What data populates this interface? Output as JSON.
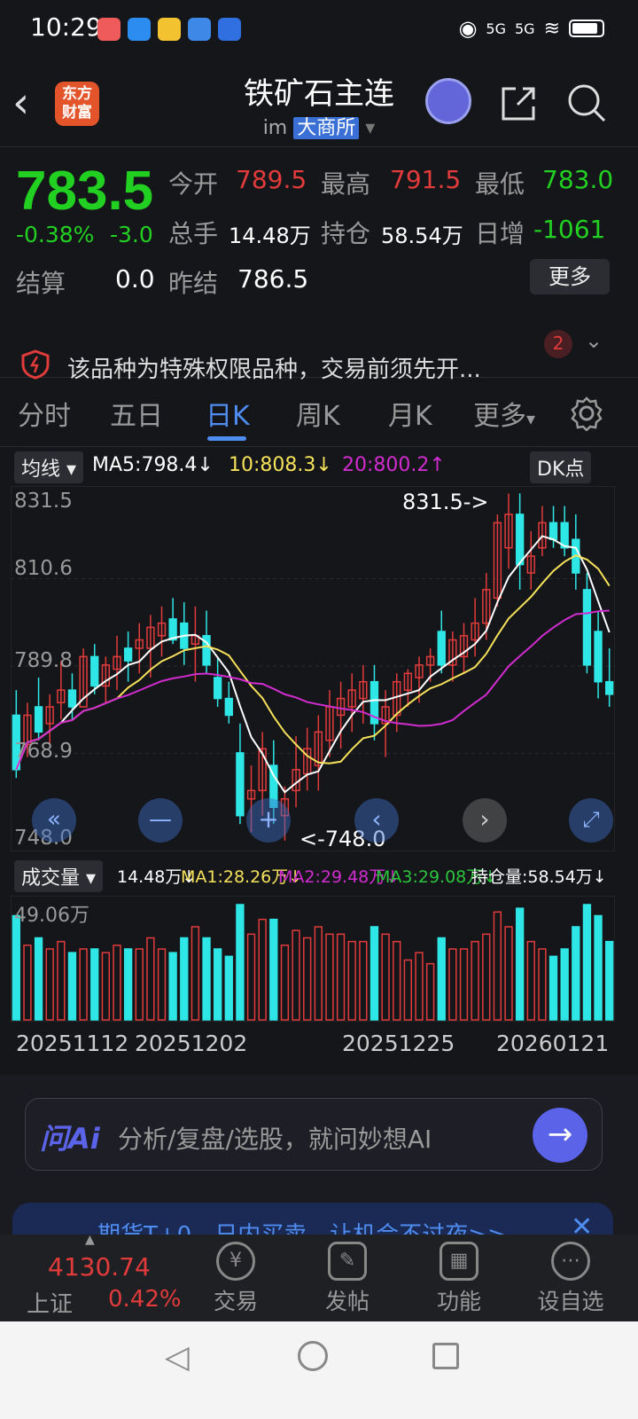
{
  "status_bar": {
    "time": "10:29",
    "signal_1": "5G",
    "signal_2": "5G"
  },
  "header": {
    "back_symbol": "‹",
    "logo_text_1": "东方",
    "logo_text_2": "财富",
    "title": "铁矿石主连",
    "sub_code": "im",
    "exchange": "大商所",
    "arrow": "▾"
  },
  "quote": {
    "price": "783.5",
    "pct": "-0.38%",
    "chg": "-3.0",
    "open_label": "今开",
    "open": "789.5",
    "high_label": "最高",
    "high": "791.5",
    "low_label": "最低",
    "low": "783.0",
    "volume_label": "总手",
    "volume": "14.48万",
    "position_label": "持仓",
    "position": "58.54万",
    "daily_inc_label": "日增",
    "daily_inc": "-1061",
    "settle_label": "结算",
    "settle": "0.0",
    "prev_settle_label": "昨结",
    "prev_settle": "786.5",
    "more": "更多"
  },
  "notice": {
    "text": "该品种为特殊权限品种，交易前须先开...",
    "badge": "2"
  },
  "tabs": [
    "分时",
    "五日",
    "日K",
    "周K",
    "月K",
    "更多"
  ],
  "tabs_more_arrow": "▾",
  "ma_bar": {
    "selector": "均线",
    "ma5": "MA5:798.4↓",
    "ma10": "10:808.3↓",
    "ma20": "20:800.2↑",
    "dk": "DK点"
  },
  "kline": {
    "axis": [
      "831.5",
      "810.6",
      "789.8",
      "768.9",
      "748.0"
    ],
    "high_marker": "831.5->",
    "low_marker": "<-748.0"
  },
  "volume_bar": {
    "selector": "成交量",
    "vol": "14.48万↓",
    "ma1": "MA1:28.26万↓",
    "ma2": "MA2:29.48万↓",
    "ma3": "MA3:29.08万↓",
    "oi": "持仓量:58.54万↓",
    "max": "49.06万"
  },
  "dates": [
    "20251112",
    "20251202",
    "20251225",
    "20260121"
  ],
  "ai": {
    "logo": "问Ai",
    "placeholder": "分析/复盘/选股，就问妙想AI"
  },
  "banner": {
    "text": "期货T+0，日内买卖，让机会不过夜>>"
  },
  "bottom_nav": {
    "index_value": "4130.74",
    "index_name": "上证",
    "index_pct": "0.42%",
    "items": [
      "交易",
      "发帖",
      "功能",
      "设自选"
    ]
  },
  "chart_data": [
    {
      "type": "candlestick",
      "title": "",
      "ylim": [
        748.0,
        831.5
      ],
      "series": [
        {
          "name": "MA5",
          "color": "#ffffff"
        },
        {
          "name": "10",
          "color": "#f5e15a"
        },
        {
          "name": "20",
          "color": "#d12ccf"
        }
      ],
      "ohlc": [
        [
          778,
          784,
          763,
          765
        ],
        [
          771,
          781,
          768,
          778
        ],
        [
          780,
          787,
          772,
          774
        ],
        [
          776,
          783,
          771,
          780
        ],
        [
          781,
          791,
          777,
          784
        ],
        [
          784,
          788,
          777,
          780
        ],
        [
          780,
          794,
          782,
          792
        ],
        [
          792,
          795,
          783,
          785
        ],
        [
          785,
          792,
          781,
          790
        ],
        [
          789,
          797,
          784,
          792
        ],
        [
          794,
          798,
          786,
          791
        ],
        [
          794,
          800,
          788,
          796
        ],
        [
          794,
          802,
          787,
          799
        ],
        [
          797,
          804,
          792,
          800
        ],
        [
          801,
          806,
          795,
          796
        ],
        [
          800,
          805,
          790,
          794
        ],
        [
          795,
          804,
          786,
          797
        ],
        [
          797,
          803,
          788,
          790
        ],
        [
          787,
          792,
          780,
          782
        ],
        [
          782,
          786,
          776,
          778
        ],
        [
          769,
          776,
          752,
          754
        ],
        [
          758,
          766,
          750,
          760
        ],
        [
          760,
          774,
          754,
          770
        ],
        [
          766,
          772,
          752,
          756
        ],
        [
          754,
          761,
          748,
          758
        ],
        [
          760,
          773,
          756,
          765
        ],
        [
          764,
          775,
          760,
          770
        ],
        [
          766,
          778,
          760,
          774
        ],
        [
          772,
          784,
          768,
          780
        ],
        [
          778,
          786,
          770,
          782
        ],
        [
          780,
          788,
          774,
          784
        ],
        [
          782,
          790,
          776,
          786
        ],
        [
          786,
          790,
          772,
          776
        ],
        [
          776,
          784,
          768,
          780
        ],
        [
          778,
          788,
          774,
          786
        ],
        [
          784,
          789,
          780,
          788
        ],
        [
          787,
          792,
          781,
          790
        ],
        [
          790,
          794,
          786,
          792
        ],
        [
          798,
          803,
          788,
          790
        ],
        [
          790,
          798,
          786,
          796
        ],
        [
          792,
          800,
          788,
          797
        ],
        [
          796,
          806,
          792,
          800
        ],
        [
          800,
          812,
          796,
          808
        ],
        [
          806,
          826,
          804,
          824
        ],
        [
          818,
          831,
          813,
          826
        ],
        [
          826,
          831,
          808,
          814
        ],
        [
          812,
          822,
          808,
          816
        ],
        [
          818,
          828,
          816,
          824
        ],
        [
          824,
          828,
          818,
          820
        ],
        [
          824,
          828,
          816,
          818
        ],
        [
          820,
          826,
          808,
          812
        ],
        [
          808,
          812,
          788,
          790
        ],
        [
          798,
          803,
          782,
          786
        ],
        [
          786,
          794,
          780,
          783
        ]
      ],
      "volume_max": "49.06万"
    }
  ]
}
